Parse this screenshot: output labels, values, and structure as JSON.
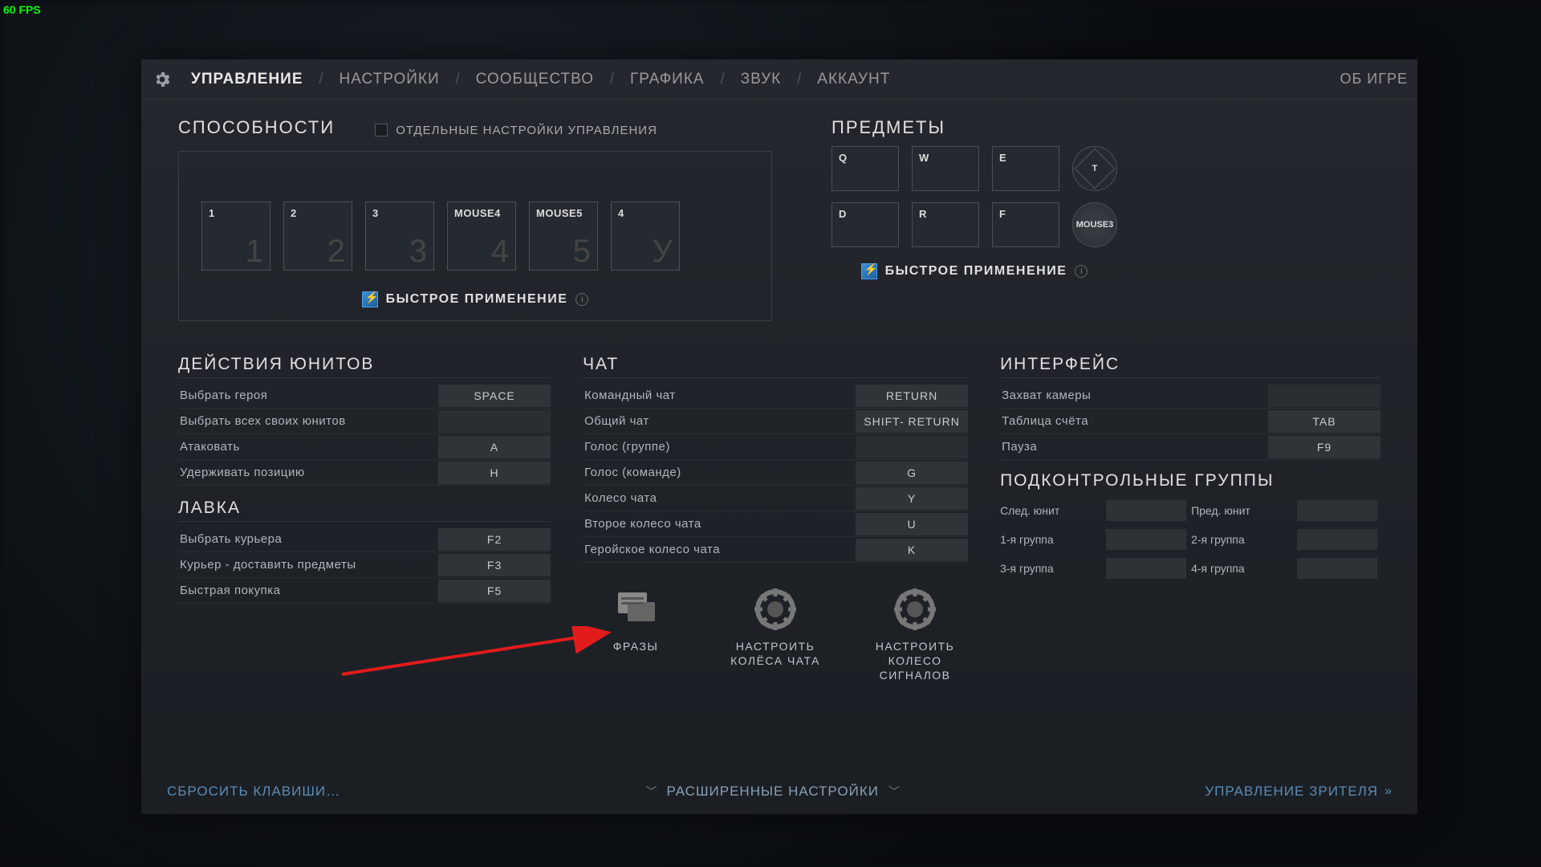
{
  "fps": "60 FPS",
  "tabs": {
    "t0": "УПРАВЛЕНИЕ",
    "t1": "НАСТРОЙКИ",
    "t2": "СООБЩЕСТВО",
    "t3": "ГРАФИКА",
    "t4": "ЗВУК",
    "t5": "АККАУНТ",
    "about": "ОБ ИГРЕ"
  },
  "abilities": {
    "title": "СПОСОБНОСТИ",
    "perHero": "ОТДЕЛЬНЫЕ НАСТРОЙКИ УПРАВЛЕНИЯ",
    "slots": [
      {
        "b": "1",
        "g": "1"
      },
      {
        "b": "2",
        "g": "2"
      },
      {
        "b": "3",
        "g": "3"
      },
      {
        "b": "MOUSE4",
        "g": "4"
      },
      {
        "b": "MOUSE5",
        "g": "5"
      },
      {
        "b": "4",
        "g": "У"
      }
    ],
    "quickcast": "БЫСТРОЕ ПРИМЕНЕНИЕ"
  },
  "items": {
    "title": "ПРЕДМЕТЫ",
    "row1": [
      {
        "b": "Q"
      },
      {
        "b": "W"
      },
      {
        "b": "E"
      }
    ],
    "row2": [
      {
        "b": "D"
      },
      {
        "b": "R"
      },
      {
        "b": "F"
      }
    ],
    "tp": "T",
    "neutral": "MOUSE3",
    "quickcast": "БЫСТРОЕ ПРИМЕНЕНИЕ"
  },
  "unit": {
    "title": "ДЕЙСТВИЯ ЮНИТОВ",
    "rows": [
      {
        "l": "Выбрать героя",
        "k": "SPACE"
      },
      {
        "l": "Выбрать всех своих юнитов",
        "k": ""
      },
      {
        "l": "Атаковать",
        "k": "A"
      },
      {
        "l": "Удерживать позицию",
        "k": "H"
      }
    ]
  },
  "shop": {
    "title": "ЛАВКА",
    "rows": [
      {
        "l": "Выбрать курьера",
        "k": "F2"
      },
      {
        "l": "Курьер - доставить предметы",
        "k": "F3"
      },
      {
        "l": "Быстрая покупка",
        "k": "F5"
      }
    ]
  },
  "chat": {
    "title": "ЧАТ",
    "rows": [
      {
        "l": "Командный чат",
        "k": "RETURN"
      },
      {
        "l": "Общий чат",
        "k": "SHIFT- RETURN"
      },
      {
        "l": "Голос (группе)",
        "k": ""
      },
      {
        "l": "Голос (команде)",
        "k": "G"
      },
      {
        "l": "Колесо чата",
        "k": "Y"
      },
      {
        "l": "Второе колесо чата",
        "k": "U"
      },
      {
        "l": "Геройское колесо чата",
        "k": "K"
      }
    ]
  },
  "iface": {
    "title": "ИНТЕРФЕЙС",
    "rows": [
      {
        "l": "Захват камеры",
        "k": ""
      },
      {
        "l": "Таблица счёта",
        "k": "TAB"
      },
      {
        "l": "Пауза",
        "k": "F9"
      }
    ]
  },
  "groups": {
    "title": "ПОДКОНТРОЛЬНЫЕ ГРУППЫ",
    "cells": [
      "След. юнит",
      "Пред. юнит",
      "1-я группа",
      "2-я группа",
      "3-я группа",
      "4-я группа"
    ]
  },
  "wheels": {
    "phrases": "ФРАЗЫ",
    "chat": "НАСТРОИТЬ КОЛЁСА ЧАТА",
    "ping": "НАСТРОИТЬ КОЛЕСО СИГНАЛОВ"
  },
  "footer": {
    "reset": "СБРОСИТЬ КЛАВИШИ…",
    "advanced": "РАСШИРЕННЫЕ НАСТРОЙКИ",
    "spectator": "УПРАВЛЕНИЕ ЗРИТЕЛЯ"
  }
}
